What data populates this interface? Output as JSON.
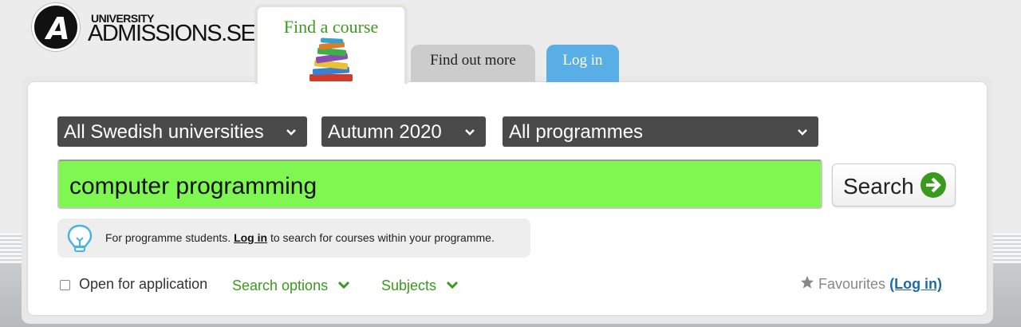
{
  "logo": {
    "letter": "A",
    "small": "UNIVERSITY",
    "big": "ADMISSIONS.SE"
  },
  "tabs": [
    {
      "label": "Find a course"
    },
    {
      "label": "Find out more"
    },
    {
      "label": "Log in"
    }
  ],
  "filters": {
    "university": "All Swedish universities",
    "semester": "Autumn 2020",
    "programme": "All programmes"
  },
  "search": {
    "value": "computer programming",
    "button_label": "Search"
  },
  "info": {
    "prefix": "For programme students. ",
    "link": "Log in",
    "suffix": " to search for courses within your programme."
  },
  "bottom": {
    "open_label": "Open for application",
    "search_options": "Search options",
    "subjects": "Subjects",
    "favourites": "Favourites",
    "fav_login": "(Log in)"
  },
  "colors": {
    "accent_green": "#3a9a1e",
    "search_bg": "#7ef751",
    "login_tab": "#5aaee6",
    "select_bg": "#4a4a4a"
  }
}
